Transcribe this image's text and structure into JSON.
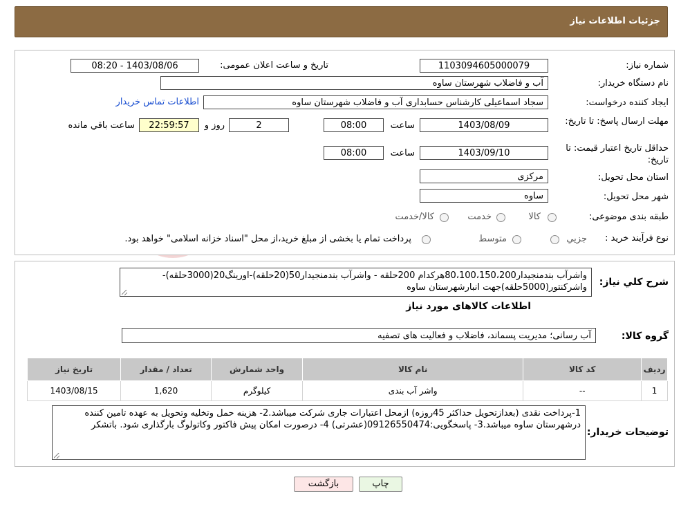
{
  "header": {
    "title": "جزئیات اطلاعات نیاز"
  },
  "form": {
    "need_number_label": "شماره نیاز:",
    "need_number": "1103094605000079",
    "announce_label": "تاریخ و ساعت اعلان عمومی:",
    "announce_value": "1403/08/06 - 08:20",
    "buyer_org_label": "نام دستگاه خریدار:",
    "buyer_org": "آب و فاضلاب شهرستان ساوه",
    "creator_label": "ایجاد کننده درخواست:",
    "creator": "سجاد اسماعیلی کارشناس حسابداری آب و فاضلاب شهرستان ساوه",
    "contact_link": "اطلاعات تماس خریدار",
    "deadline_label": "مهلت ارسال پاسخ: تا تاریخ:",
    "deadline_date": "1403/08/09",
    "time_label": "ساعت",
    "deadline_time": "08:00",
    "days_value": "2",
    "days_label": "روز و",
    "remaining_time": "22:59:57",
    "remaining_label": "ساعت باقي مانده",
    "validity_label": "حداقل تاریخ اعتبار قیمت: تا تاریخ:",
    "validity_date": "1403/09/10",
    "validity_time": "08:00",
    "province_label": "استان محل تحویل:",
    "province": "مرکزی",
    "city_label": "شهر محل تحویل:",
    "city": "ساوه",
    "category_label": "طبقه بندی موضوعی:",
    "category_options": [
      "کالا",
      "خدمت",
      "کالا/خدمت"
    ],
    "process_label": "نوع فرآیند خرید :",
    "process_options": [
      "جزیي",
      "متوسط"
    ],
    "process_note": "پرداخت تمام یا بخشی از مبلغ خرید،از محل \"اسناد خزانه اسلامی\" خواهد بود."
  },
  "description": {
    "label": "شرح کلي نياز:",
    "text": "واشرآب بندمنجیدار80،100،150،200هرکدام 200حلقه - واشرآب بندمنجیدار50(20حلقه)-اورینگ20(3000حلقه)-واشرکنتور(5000حلقه)جهت انبارشهرستان ساوه"
  },
  "goods": {
    "section_title": "اطلاعات کالاهای مورد نیاز",
    "group_label": "گروه کالا:",
    "group_value": "آب رسانی؛ مدیریت پسماند، فاضلاب و فعالیت های تصفیه",
    "columns": [
      "ردیف",
      "کد کالا",
      "نام کالا",
      "واحد شمارش",
      "تعداد / مقدار",
      "تاریخ نیاز"
    ],
    "rows": [
      {
        "row": "1",
        "code": "--",
        "name": "واشر آب بندی",
        "unit": "کیلوگرم",
        "qty": "1,620",
        "date": "1403/08/15"
      }
    ]
  },
  "buyer_notes": {
    "label": "توضیحات خریدار:",
    "text": "1-پرداخت  نقدی (بعدازتحویل حداکثر 45روزه) ازمحل اعتبارات جاری شرکت میباشد.2- هزینه حمل وتخلیه وتحویل به عهده تامین کننده درشهرستان ساوه میباشد.3- پاسخگویی:09126550474(عشرتی) 4- درصورت امکان پیش فاکتور وکاتولوگ بارگذاری شود. باتشکر"
  },
  "buttons": {
    "print": "چاپ",
    "back": "بازگشت"
  },
  "watermark": {
    "text": "AriaTender.neT"
  }
}
